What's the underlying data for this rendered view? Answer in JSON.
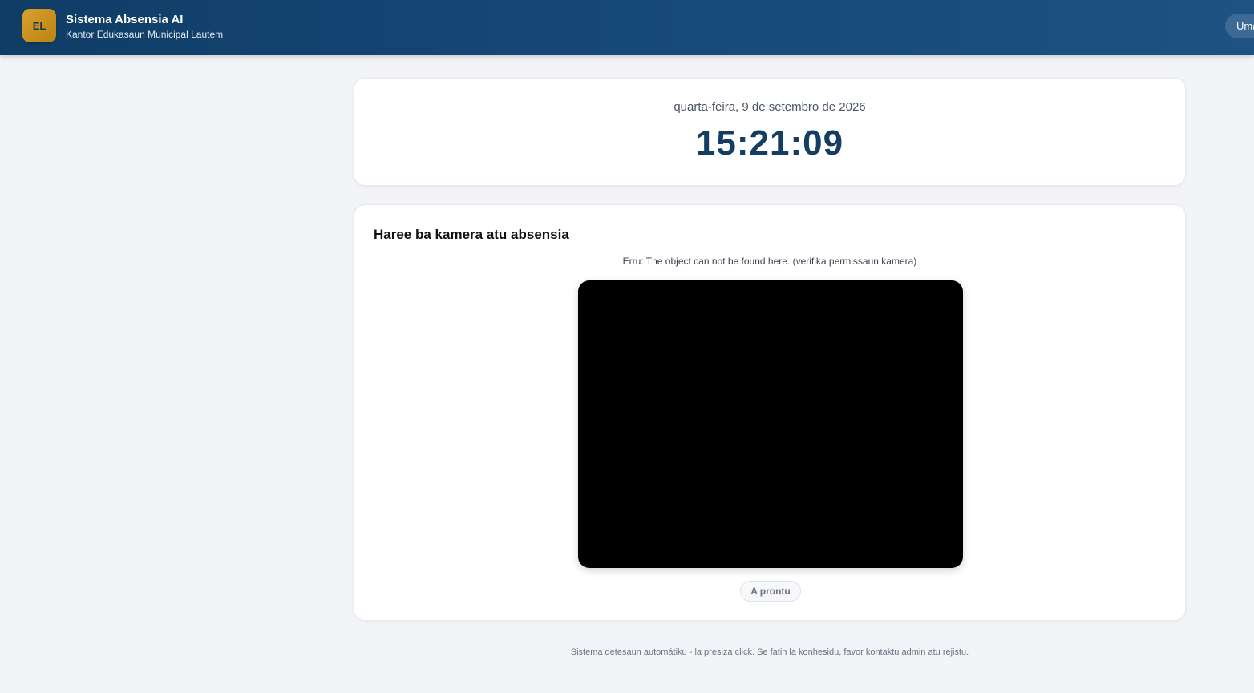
{
  "header": {
    "logo_text": "EL",
    "title": "Sistema Absensia AI",
    "subtitle": "Kantor Edukasaun Municipal Lautem",
    "user_label": "Uma"
  },
  "clock": {
    "date": "quarta-feira, 9 de setembro de 2026",
    "time": "15:21:09"
  },
  "camera": {
    "title": "Haree ba kamera atu absensia",
    "error": "Erru: The object can not be found here. (verifika permissaun kamera)",
    "status_label": "A prontu"
  },
  "footer": {
    "note": "Sistema detesaun automátiku - la presiza click. Se fatin la konhesidu, favor kontaktu admin atu rejistu."
  },
  "colors": {
    "header_bg": "#143f6b",
    "logo_bg": "#c8921e",
    "time_text": "#143d63",
    "page_bg": "#f3f4f7"
  }
}
